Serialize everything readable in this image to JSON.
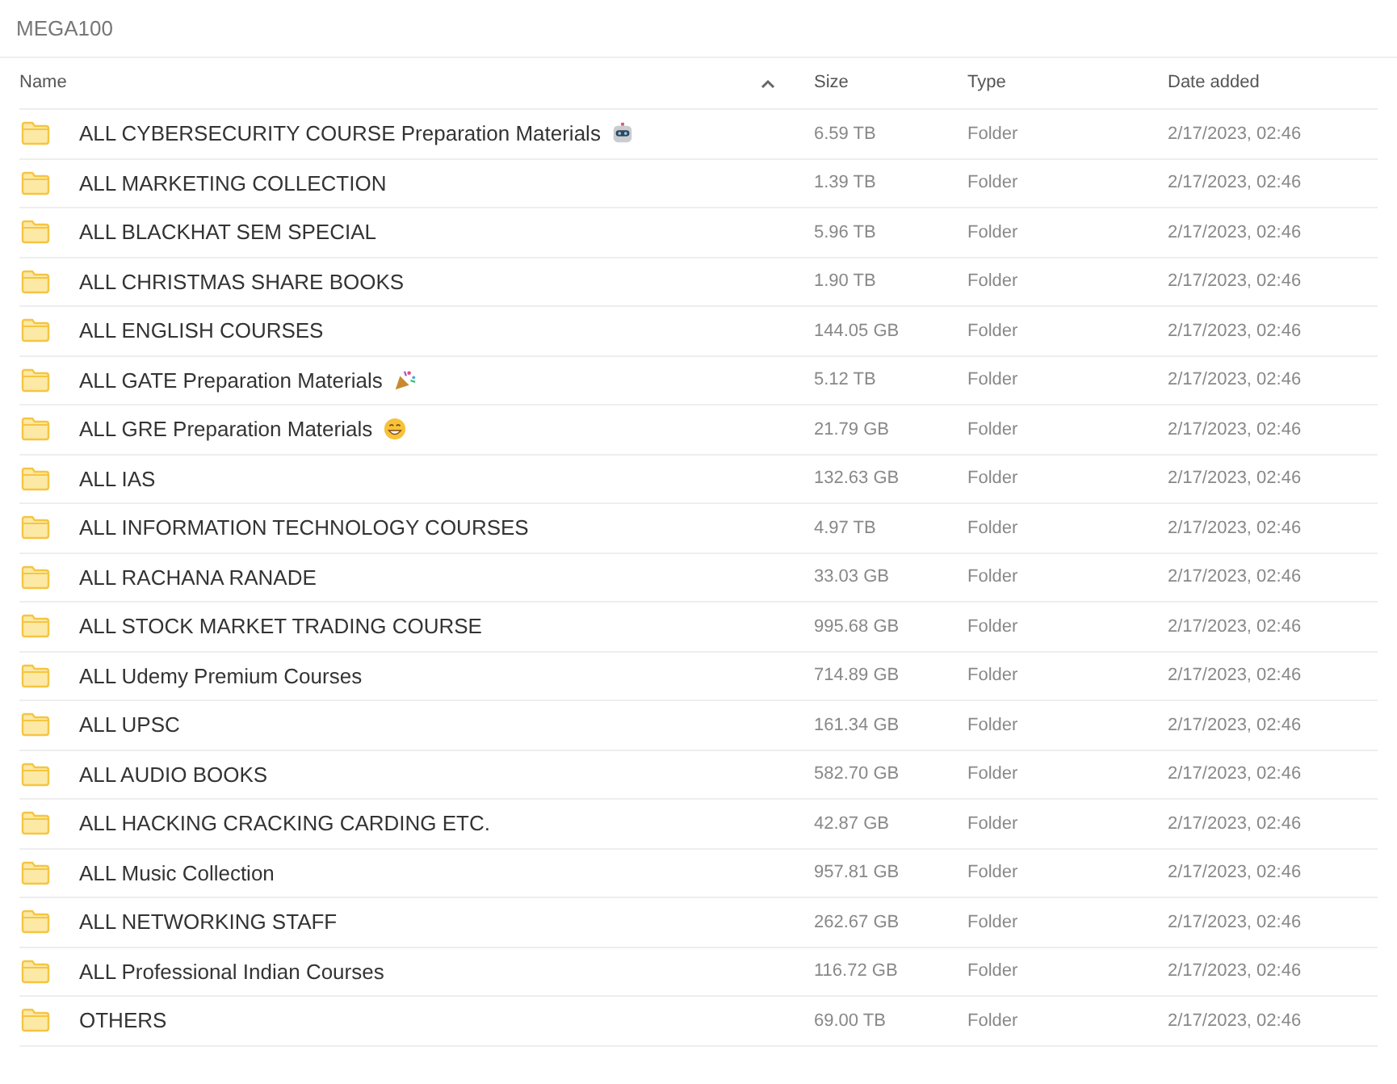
{
  "title": "MEGA100",
  "columns": [
    {
      "label": "Name",
      "sorted": true
    },
    {
      "label": "Size",
      "sorted": false
    },
    {
      "label": "Type",
      "sorted": false
    },
    {
      "label": "Date added",
      "sorted": false
    }
  ],
  "rows": [
    {
      "name": "ALL CYBERSECURITY COURSE Preparation Materials",
      "kind": "robot",
      "size": "6.59 TB",
      "type": "Folder",
      "date": "2/17/2023, 02:46"
    },
    {
      "name": "ALL MARKETING COLLECTION",
      "kind": "plain",
      "size": "1.39 TB",
      "type": "Folder",
      "date": "2/17/2023, 02:46"
    },
    {
      "name": "ALL BLACKHAT SEM SPECIAL",
      "kind": "plain",
      "size": "5.96 TB",
      "type": "Folder",
      "date": "2/17/2023, 02:46"
    },
    {
      "name": "ALL CHRISTMAS SHARE BOOKS",
      "kind": "plain",
      "size": "1.90 TB",
      "type": "Folder",
      "date": "2/17/2023, 02:46"
    },
    {
      "name": "ALL ENGLISH COURSES",
      "kind": "plain",
      "size": "144.05 GB",
      "type": "Folder",
      "date": "2/17/2023, 02:46"
    },
    {
      "name": "ALL GATE Preparation Materials",
      "kind": "party",
      "size": "5.12 TB",
      "type": "Folder",
      "date": "2/17/2023, 02:46"
    },
    {
      "name": "ALL GRE Preparation Materials",
      "kind": "grin",
      "size": "21.79 GB",
      "type": "Folder",
      "date": "2/17/2023, 02:46"
    },
    {
      "name": "ALL IAS",
      "kind": "plain",
      "size": "132.63 GB",
      "type": "Folder",
      "date": "2/17/2023, 02:46"
    },
    {
      "name": "ALL INFORMATION TECHNOLOGY COURSES",
      "kind": "plain",
      "size": "4.97 TB",
      "type": "Folder",
      "date": "2/17/2023, 02:46"
    },
    {
      "name": "ALL RACHANA RANADE",
      "kind": "plain",
      "size": "33.03 GB",
      "type": "Folder",
      "date": "2/17/2023, 02:46"
    },
    {
      "name": "ALL STOCK MARKET TRADING COURSE",
      "kind": "plain",
      "size": "995.68 GB",
      "type": "Folder",
      "date": "2/17/2023, 02:46"
    },
    {
      "name": "ALL Udemy Premium Courses",
      "kind": "plain",
      "size": "714.89 GB",
      "type": "Folder",
      "date": "2/17/2023, 02:46"
    },
    {
      "name": "ALL UPSC",
      "kind": "plain",
      "size": "161.34 GB",
      "type": "Folder",
      "date": "2/17/2023, 02:46"
    },
    {
      "name": "ALL AUDIO BOOKS",
      "kind": "plain",
      "size": "582.70 GB",
      "type": "Folder",
      "date": "2/17/2023, 02:46"
    },
    {
      "name": "ALL HACKING CRACKING CARDING ETC.",
      "kind": "plain",
      "size": "42.87 GB",
      "type": "Folder",
      "date": "2/17/2023, 02:46"
    },
    {
      "name": "ALL Music Collection",
      "kind": "plain",
      "size": "957.81 GB",
      "type": "Folder",
      "date": "2/17/2023, 02:46"
    },
    {
      "name": "ALL NETWORKING STAFF",
      "kind": "plain",
      "size": "262.67 GB",
      "type": "Folder",
      "date": "2/17/2023, 02:46"
    },
    {
      "name": "ALL Professional Indian Courses",
      "kind": "plain",
      "size": "116.72 GB",
      "type": "Folder",
      "date": "2/17/2023, 02:46"
    },
    {
      "name": "OTHERS",
      "kind": "plain",
      "size": "69.00 TB",
      "type": "Folder",
      "date": "2/17/2023, 02:46"
    }
  ]
}
